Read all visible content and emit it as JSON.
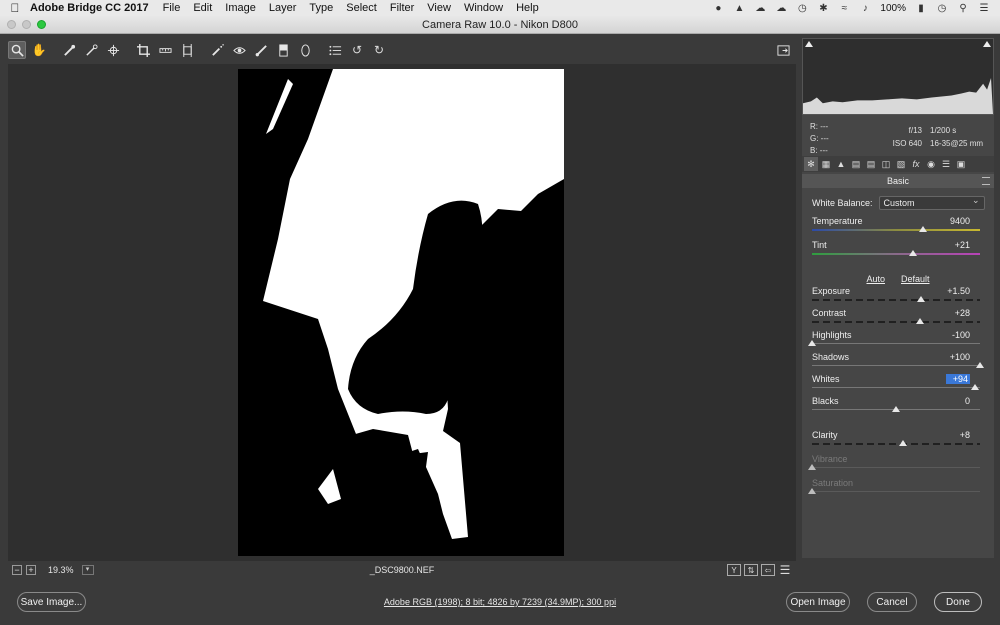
{
  "menubar": {
    "app_name": "Adobe Bridge CC 2017",
    "items": [
      "File",
      "Edit",
      "Image",
      "Layer",
      "Type",
      "Select",
      "Filter",
      "View",
      "Window",
      "Help"
    ],
    "battery": "100%"
  },
  "window": {
    "title": "Camera Raw 10.0  -  Nikon D800"
  },
  "preview": {
    "zoom": "19.3%",
    "filename": "_DSC9800.NEF"
  },
  "bottom": {
    "save_label": "Save Image...",
    "workflow_text": "Adobe RGB (1998); 8 bit; 4826 by 7239 (34.9MP); 300 ppi",
    "open_label": "Open Image",
    "cancel_label": "Cancel",
    "done_label": "Done"
  },
  "info": {
    "r": "R:   ---",
    "g": "G:   ---",
    "b": "B:   ---",
    "aperture": "f/13",
    "shutter": "1/200 s",
    "iso": "ISO 640",
    "lens": "16-35@25 mm"
  },
  "panel": {
    "title": "Basic",
    "white_balance_label": "White Balance:",
    "white_balance_value": "Custom",
    "auto_label": "Auto",
    "default_label": "Default",
    "sliders": [
      {
        "label": "Temperature",
        "value": "9400",
        "pos": 0.66
      },
      {
        "label": "Tint",
        "value": "+21",
        "pos": 0.6
      },
      {
        "label": "Exposure",
        "value": "+1.50",
        "pos": 0.65
      },
      {
        "label": "Contrast",
        "value": "+28",
        "pos": 0.64
      },
      {
        "label": "Highlights",
        "value": "-100",
        "pos": 0.0
      },
      {
        "label": "Shadows",
        "value": "+100",
        "pos": 1.0
      },
      {
        "label": "Whites",
        "value": "+94",
        "pos": 0.97
      },
      {
        "label": "Blacks",
        "value": "0",
        "pos": 0.5
      },
      {
        "label": "Clarity",
        "value": "+8",
        "pos": 0.54
      },
      {
        "label": "Vibrance",
        "value": "",
        "pos": 0.0
      },
      {
        "label": "Saturation",
        "value": "",
        "pos": 0.0
      }
    ]
  },
  "colors": {
    "accent_selection": "#3a78d8",
    "panel_bg": "#464646",
    "preview_bg": "#2f2f2f"
  }
}
